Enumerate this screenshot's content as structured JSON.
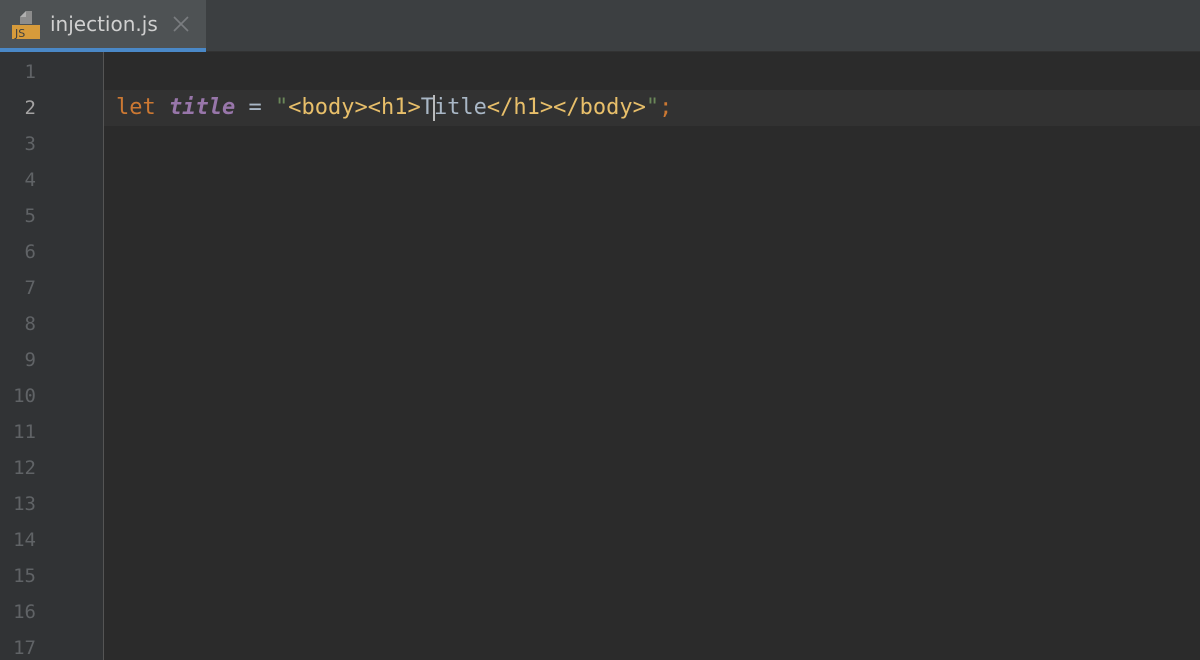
{
  "tab": {
    "icon": "javascript-file-icon",
    "icon_text": "JS",
    "title": "injection.js",
    "close_icon": "close-icon"
  },
  "editor": {
    "line_numbers": [
      "1",
      "2",
      "3",
      "4",
      "5",
      "6",
      "7",
      "8",
      "9",
      "10",
      "11",
      "12",
      "13",
      "14",
      "15",
      "16",
      "17"
    ],
    "current_line": 2,
    "code_tokens": {
      "keyword": "let",
      "variable": "title",
      "operator": "=",
      "quote_open": "\"",
      "tag_open": "<body><h1>",
      "text_before_caret": "T",
      "text_after_caret": "itle",
      "tag_close": "</h1></body>",
      "quote_close": "\"",
      "semicolon": ";"
    }
  },
  "colors": {
    "background": "#2b2b2b",
    "gutter": "#313335",
    "tab_accent": "#4a88c7",
    "keyword": "#cc7832",
    "variable": "#9876aa",
    "string": "#6a8759",
    "injected_tag": "#e8bf6a",
    "default_text": "#a9b7c6"
  }
}
